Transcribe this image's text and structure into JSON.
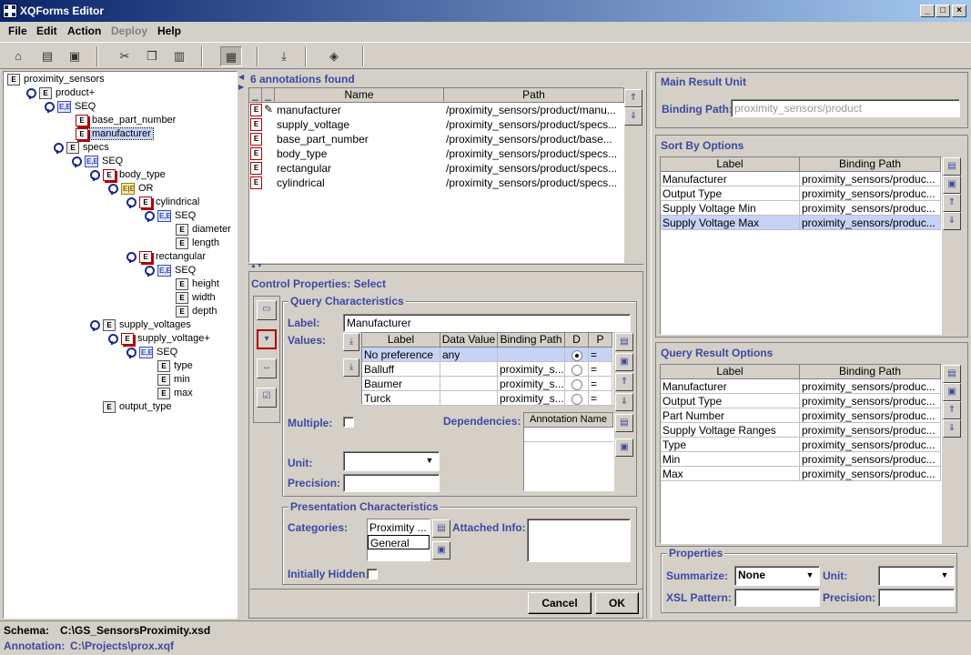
{
  "window": {
    "title": "XQForms Editor"
  },
  "menu": [
    {
      "label": "File",
      "enabled": true
    },
    {
      "label": "Edit",
      "enabled": true
    },
    {
      "label": "Action",
      "enabled": true
    },
    {
      "label": "Deploy",
      "enabled": false
    },
    {
      "label": "Help",
      "enabled": true
    }
  ],
  "toolbar": {
    "icons": [
      "open-icon",
      "new-icon",
      "save-icon",
      "cut-icon",
      "copy-icon",
      "paste-icon",
      "form-icon",
      "import-icon",
      "deploy-icon"
    ]
  },
  "tree": [
    {
      "label": "proximity_sensors",
      "type": "E"
    },
    {
      "label": "product+",
      "type": "E"
    },
    {
      "label": "SEQ",
      "type": "SEQ"
    },
    {
      "label": "base_part_number",
      "type": "E"
    },
    {
      "label": "manufacturer",
      "type": "E"
    },
    {
      "label": "specs",
      "type": "E"
    },
    {
      "label": "SEQ",
      "type": "SEQ"
    },
    {
      "label": "body_type",
      "type": "E"
    },
    {
      "label": "OR",
      "type": "OR"
    },
    {
      "label": "cylindrical",
      "type": "E"
    },
    {
      "label": "SEQ",
      "type": "SEQ"
    },
    {
      "label": "diameter",
      "type": "E"
    },
    {
      "label": "length",
      "type": "E"
    },
    {
      "label": "rectangular",
      "type": "E"
    },
    {
      "label": "SEQ",
      "type": "SEQ"
    },
    {
      "label": "height",
      "type": "E"
    },
    {
      "label": "width",
      "type": "E"
    },
    {
      "label": "depth",
      "type": "E"
    },
    {
      "label": "supply_voltages",
      "type": "E"
    },
    {
      "label": "supply_voltage+",
      "type": "E"
    },
    {
      "label": "SEQ",
      "type": "SEQ"
    },
    {
      "label": "type",
      "type": "E"
    },
    {
      "label": "min",
      "type": "E"
    },
    {
      "label": "max",
      "type": "E"
    },
    {
      "label": "output_type",
      "type": "E"
    }
  ],
  "annotations": {
    "count_label": "6 annotations found",
    "columns": [
      "Name",
      "Path"
    ],
    "rows": [
      {
        "name": "manufacturer",
        "path": "/proximity_sensors/product/manu..."
      },
      {
        "name": "supply_voltage",
        "path": "/proximity_sensors/product/specs..."
      },
      {
        "name": "base_part_number",
        "path": "/proximity_sensors/product/base..."
      },
      {
        "name": "body_type",
        "path": "/proximity_sensors/product/specs..."
      },
      {
        "name": "rectangular",
        "path": "/proximity_sensors/product/specs..."
      },
      {
        "name": "cylindrical",
        "path": "/proximity_sensors/product/specs..."
      }
    ]
  },
  "control": {
    "title": "Control Properties: Select",
    "query_title": "Query Characteristics",
    "label_label": "Label:",
    "label_value": "Manufacturer",
    "values_label": "Values:",
    "values_columns": [
      "Label",
      "Data Value",
      "Binding Path",
      "D",
      "P"
    ],
    "values_rows": [
      {
        "label": "No preference",
        "data": "any",
        "path": "",
        "p": "="
      },
      {
        "label": "Balluff",
        "data": "",
        "path": "proximity_s...",
        "p": "="
      },
      {
        "label": "Baumer",
        "data": "",
        "path": "proximity_s...",
        "p": "="
      },
      {
        "label": "Turck",
        "data": "",
        "path": "proximity_s...",
        "p": "="
      }
    ],
    "multiple_label": "Multiple:",
    "dependencies_label": "Dependencies:",
    "dependencies_column": "Annotation Name",
    "unit_label": "Unit:",
    "precision_label": "Precision:",
    "presentation_title": "Presentation Characteristics",
    "categories_label": "Categories:",
    "categories": [
      "Proximity ...",
      "General"
    ],
    "attached_label": "Attached Info:",
    "hidden_label": "Initially Hidden:",
    "cancel": "Cancel",
    "ok": "OK"
  },
  "main_result": {
    "title": "Main Result Unit",
    "binding_label": "Binding Path:",
    "binding_value": "proximity_sensors/product"
  },
  "sort_by": {
    "title": "Sort By Options",
    "columns": [
      "Label",
      "Binding Path"
    ],
    "rows": [
      {
        "label": "Manufacturer",
        "path": "proximity_sensors/produc..."
      },
      {
        "label": "Output Type",
        "path": "proximity_sensors/produc..."
      },
      {
        "label": "Supply Voltage Min",
        "path": "proximity_sensors/produc..."
      },
      {
        "label": "Supply Voltage Max",
        "path": "proximity_sensors/produc..."
      }
    ]
  },
  "query_result": {
    "title": "Query Result Options",
    "columns": [
      "Label",
      "Binding Path"
    ],
    "rows": [
      {
        "label": "Manufacturer",
        "path": "proximity_sensors/produc..."
      },
      {
        "label": "Output Type",
        "path": "proximity_sensors/produc..."
      },
      {
        "label": "Part Number",
        "path": "proximity_sensors/produc..."
      },
      {
        "label": "Supply Voltage Ranges",
        "path": "proximity_sensors/produc..."
      },
      {
        "label": "Type",
        "path": "proximity_sensors/produc..."
      },
      {
        "label": "Min",
        "path": "proximity_sensors/produc..."
      },
      {
        "label": "Max",
        "path": "proximity_sensors/produc..."
      }
    ]
  },
  "properties": {
    "title": "Properties",
    "summarize_label": "Summarize:",
    "summarize_value": "None",
    "unit_label": "Unit:",
    "xsl_label": "XSL Pattern:",
    "precision_label": "Precision:"
  },
  "status": {
    "schema_label": "Schema:",
    "schema_value": "C:\\GS_SensorsProximity.xsd",
    "annotation_label": "Annotation:",
    "annotation_value": "C:\\Projects\\prox.xqf"
  },
  "colors": {
    "accent": "#3b4aa0",
    "selection": "#c6d3f7",
    "title_start": "#0a246a"
  }
}
